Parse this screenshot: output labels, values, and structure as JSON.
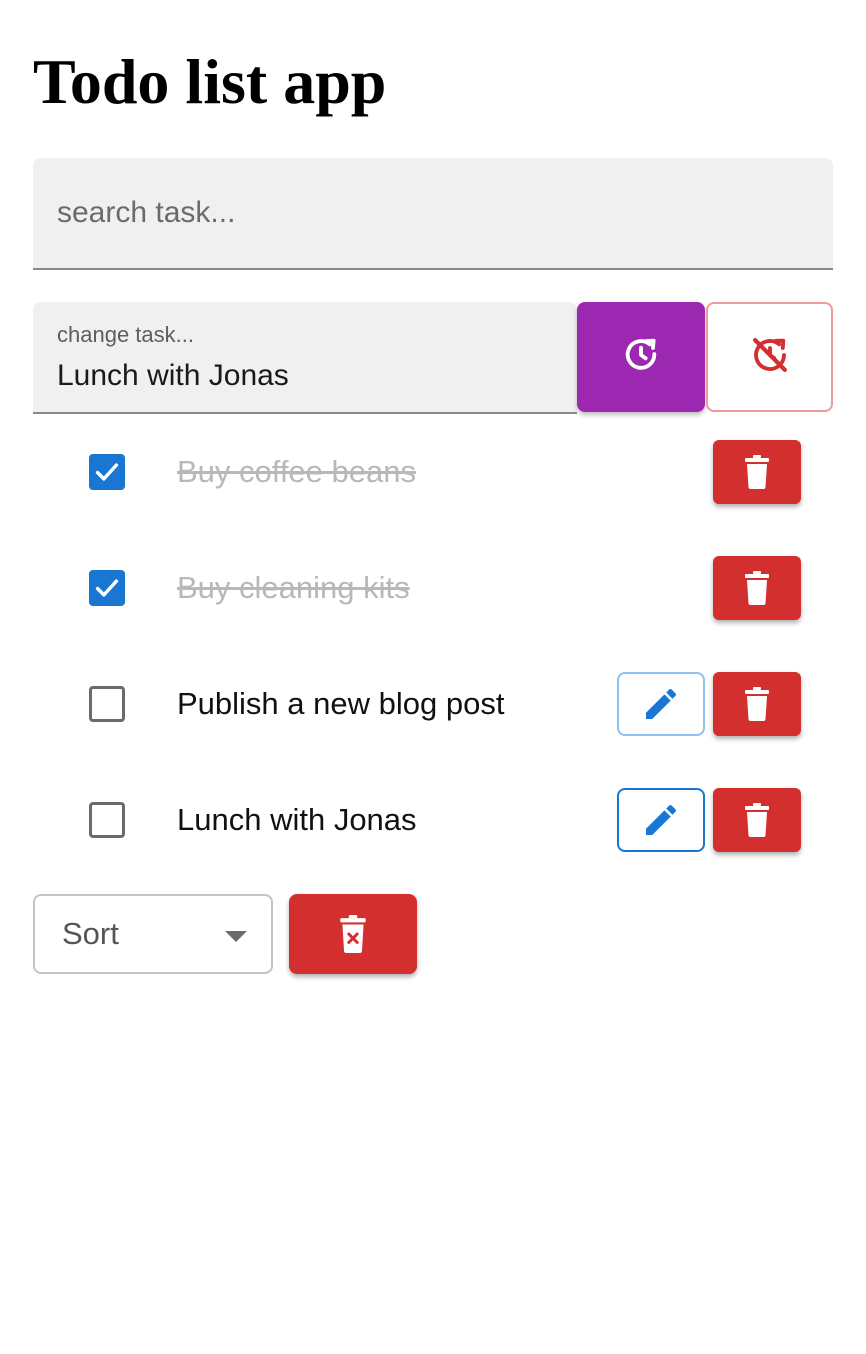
{
  "app": {
    "title": "Todo list app"
  },
  "search": {
    "placeholder": "search task...",
    "value": ""
  },
  "edit": {
    "label": "change task...",
    "value": "Lunch with Jonas"
  },
  "buttons": {
    "update_icon": "clock-refresh-icon",
    "cancel_icon": "timer-off-icon",
    "edit_icon": "pencil-icon",
    "delete_icon": "trash-icon",
    "clear_all_icon": "trash-x-icon"
  },
  "todos": [
    {
      "text": "Buy coffee beans",
      "completed": true
    },
    {
      "text": "Buy cleaning kits",
      "completed": true
    },
    {
      "text": "Publish a new blog post",
      "completed": false
    },
    {
      "text": "Lunch with Jonas",
      "completed": false
    }
  ],
  "sort": {
    "selected": "Sort"
  },
  "colors": {
    "primary": "#1976d2",
    "secondary": "#9c27b0",
    "error": "#d32f2f",
    "error_light": "#ef9a9a"
  }
}
